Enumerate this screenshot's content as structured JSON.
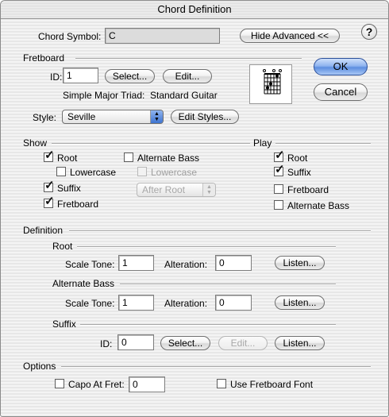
{
  "window": {
    "title": "Chord Definition"
  },
  "chord_symbol": {
    "label": "Chord Symbol:",
    "value": "C"
  },
  "buttons": {
    "hide_advanced": "Hide Advanced <<",
    "ok": "OK",
    "cancel": "Cancel",
    "help": "?"
  },
  "fretboard": {
    "section": "Fretboard",
    "id_label": "ID:",
    "id_value": "1",
    "select": "Select...",
    "edit": "Edit...",
    "description": "Simple Major Triad:",
    "instrument": "Standard Guitar",
    "style_label": "Style:",
    "style_value": "Seville",
    "edit_styles": "Edit Styles..."
  },
  "show": {
    "section": "Show",
    "root": "Root",
    "root_checked": true,
    "lowercase": "Lowercase",
    "lowercase_checked": false,
    "suffix": "Suffix",
    "suffix_checked": true,
    "fretboard": "Fretboard",
    "fretboard_checked": true,
    "alternate_bass": "Alternate Bass",
    "alternate_bass_checked": false,
    "alt_lowercase": "Lowercase",
    "alt_lowercase_checked": false,
    "after_root": "After Root"
  },
  "play": {
    "section": "Play",
    "root": "Root",
    "root_checked": true,
    "suffix": "Suffix",
    "suffix_checked": true,
    "fretboard": "Fretboard",
    "fretboard_checked": false,
    "alternate_bass": "Alternate Bass",
    "alternate_bass_checked": false
  },
  "definition": {
    "section": "Definition",
    "root": {
      "heading": "Root",
      "scale_tone_label": "Scale Tone:",
      "scale_tone": "1",
      "alteration_label": "Alteration:",
      "alteration": "0",
      "listen": "Listen..."
    },
    "alternate_bass": {
      "heading": "Alternate Bass",
      "scale_tone_label": "Scale Tone:",
      "scale_tone": "1",
      "alteration_label": "Alteration:",
      "alteration": "0",
      "listen": "Listen..."
    },
    "suffix": {
      "heading": "Suffix",
      "id_label": "ID:",
      "id_value": "0",
      "select": "Select...",
      "edit": "Edit...",
      "listen": "Listen..."
    }
  },
  "options": {
    "section": "Options",
    "capo_label": "Capo At Fret:",
    "capo_checked": false,
    "capo_value": "0",
    "use_fretboard_font": "Use Fretboard Font",
    "use_fretboard_font_checked": false
  }
}
